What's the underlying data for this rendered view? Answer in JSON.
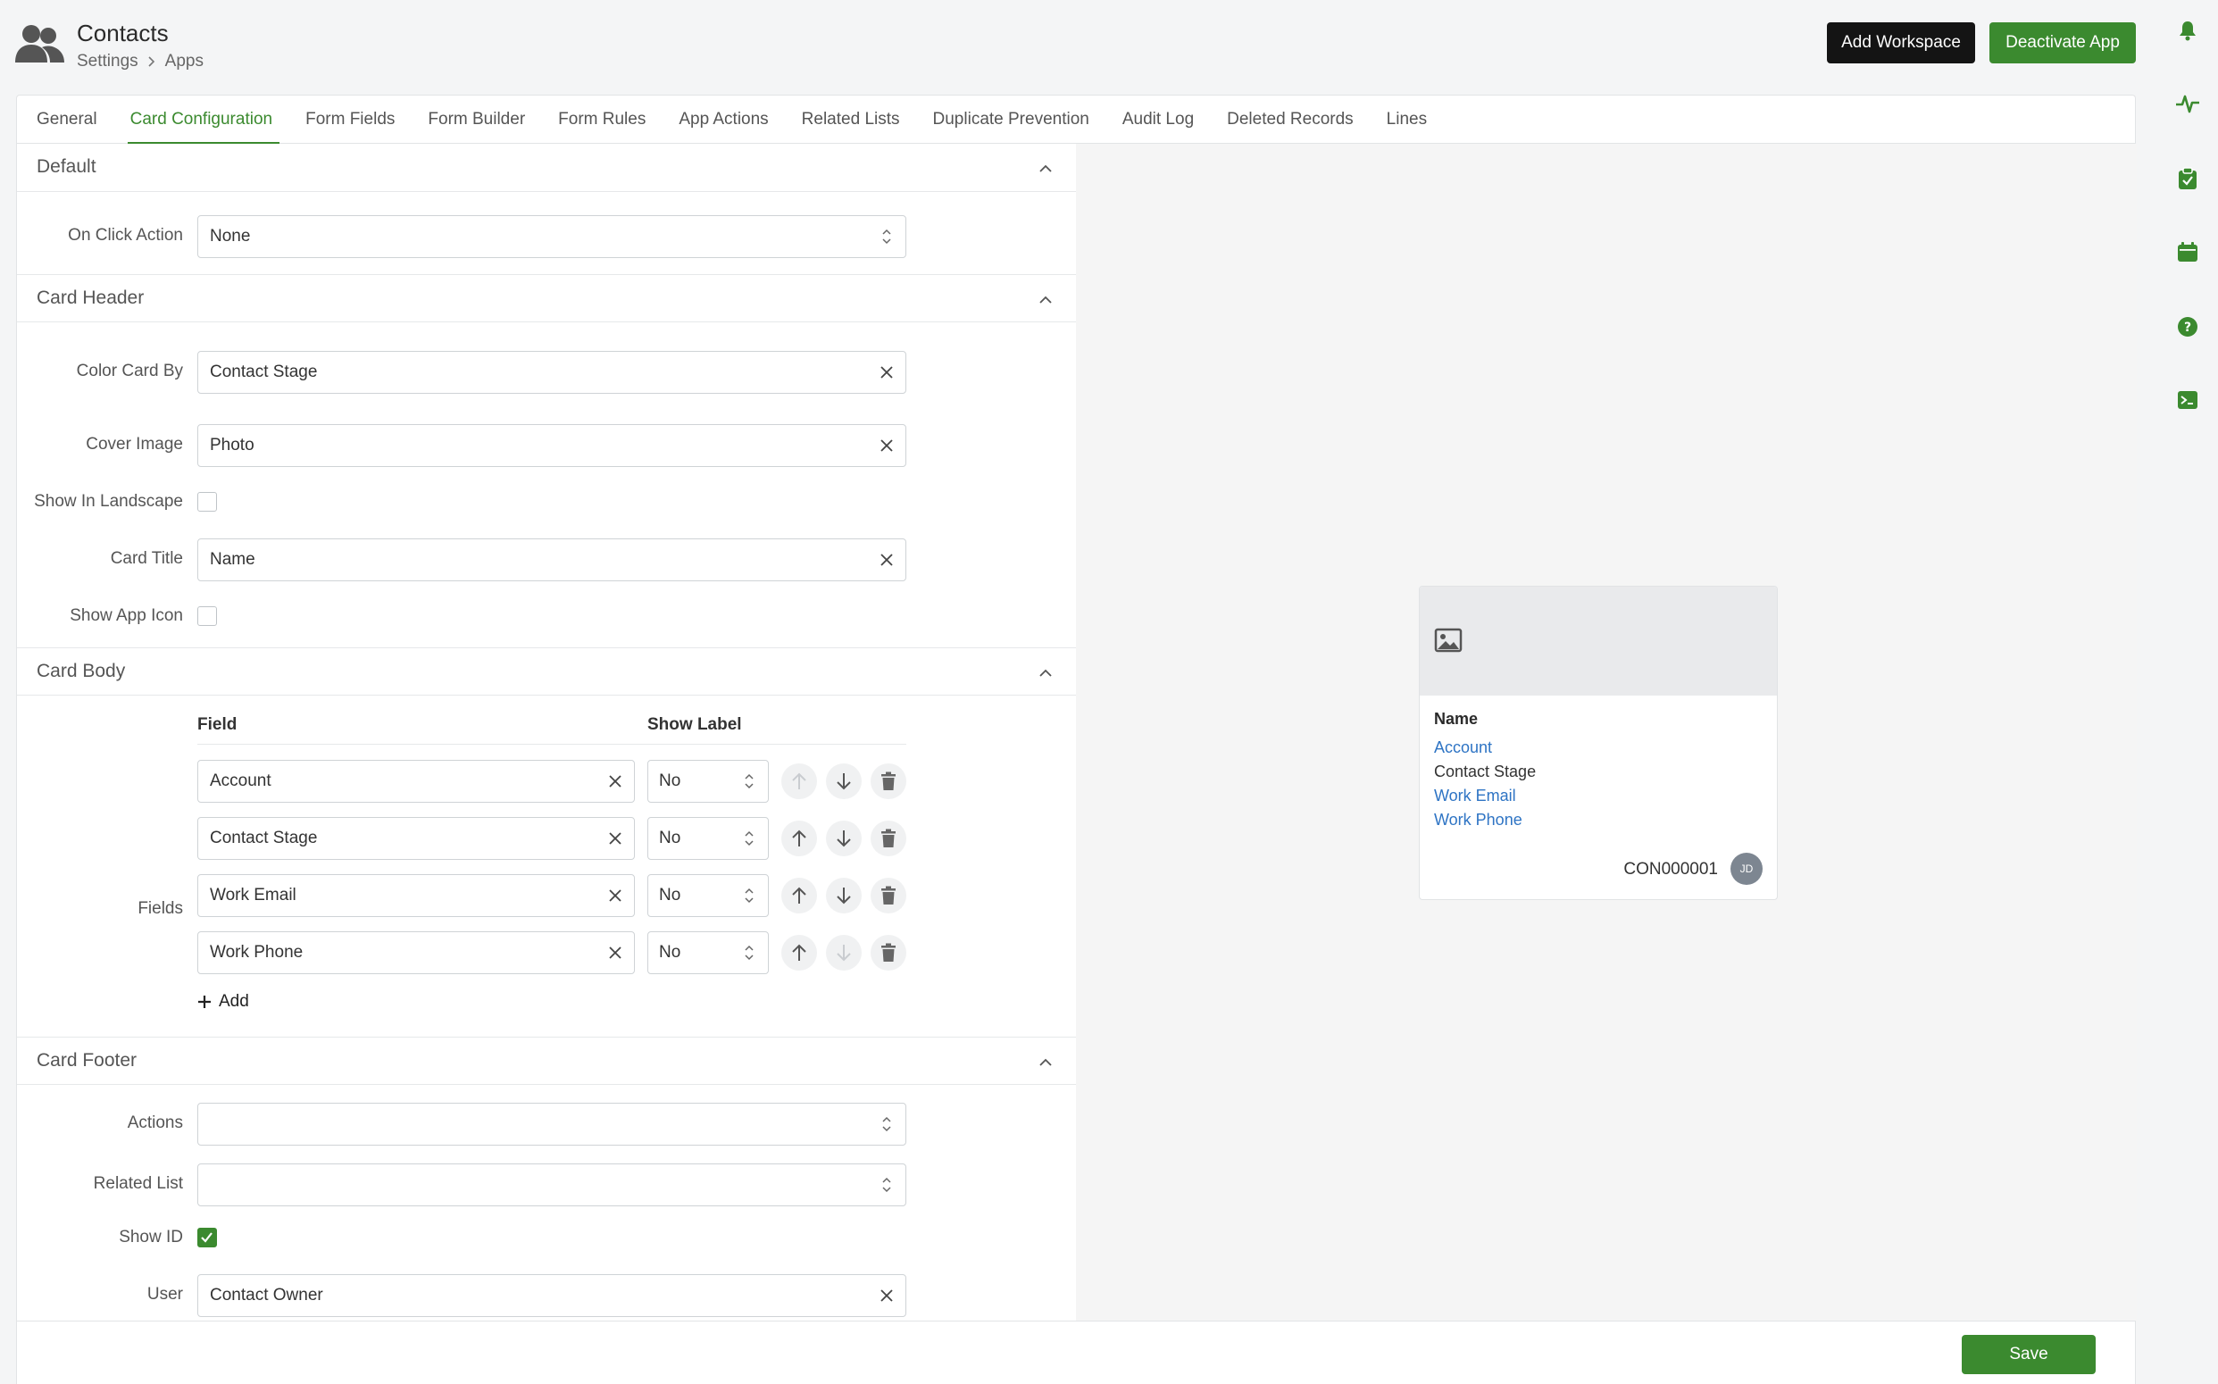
{
  "header": {
    "title": "Contacts",
    "breadcrumb": [
      "Settings",
      "Apps"
    ],
    "add_workspace_label": "Add Workspace",
    "deactivate_label": "Deactivate App"
  },
  "tabs": [
    {
      "label": "General",
      "active": false
    },
    {
      "label": "Card Configuration",
      "active": true
    },
    {
      "label": "Form Fields",
      "active": false
    },
    {
      "label": "Form Builder",
      "active": false
    },
    {
      "label": "Form Rules",
      "active": false
    },
    {
      "label": "App Actions",
      "active": false
    },
    {
      "label": "Related Lists",
      "active": false
    },
    {
      "label": "Duplicate Prevention",
      "active": false
    },
    {
      "label": "Audit Log",
      "active": false
    },
    {
      "label": "Deleted Records",
      "active": false
    },
    {
      "label": "Lines",
      "active": false
    }
  ],
  "sections": {
    "default": {
      "title": "Default",
      "on_click_label": "On Click Action",
      "on_click_value": "None"
    },
    "header": {
      "title": "Card Header",
      "color_by_label": "Color Card By",
      "color_by_value": "Contact Stage",
      "cover_label": "Cover Image",
      "cover_value": "Photo",
      "landscape_label": "Show In Landscape",
      "title_label": "Card Title",
      "title_value": "Name",
      "app_icon_label": "Show App Icon"
    },
    "body": {
      "title": "Card Body",
      "fields_label": "Fields",
      "col_field": "Field",
      "col_show_label": "Show Label",
      "rows": [
        {
          "field": "Account",
          "show_label": "No"
        },
        {
          "field": "Contact Stage",
          "show_label": "No"
        },
        {
          "field": "Work Email",
          "show_label": "No"
        },
        {
          "field": "Work Phone",
          "show_label": "No"
        }
      ],
      "add_label": "Add"
    },
    "footer": {
      "title": "Card Footer",
      "actions_label": "Actions",
      "related_label": "Related List",
      "show_id_label": "Show ID",
      "user_label": "User",
      "user_value": "Contact Owner"
    }
  },
  "save_label": "Save",
  "preview": {
    "title": "Name",
    "lines": [
      "Account",
      "Contact Stage",
      "Work Email",
      "Work Phone"
    ],
    "record_id": "CON000001",
    "avatar_initials": "JD"
  },
  "colors": {
    "accent": "#3b8a2f",
    "link": "#2e74c4",
    "dark_button": "#141414"
  }
}
